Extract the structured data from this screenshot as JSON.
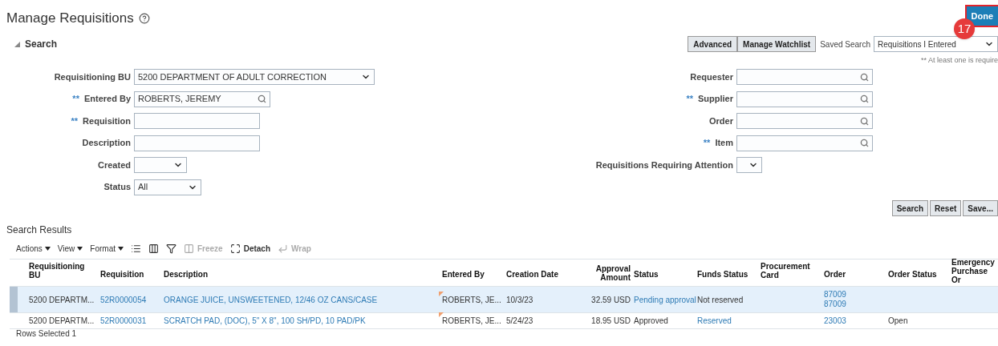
{
  "page": {
    "title": "Manage Requisitions",
    "done_button": "Done",
    "callout": "17"
  },
  "search": {
    "title": "Search",
    "expanded": true,
    "buttons": [
      "Advanced",
      "Manage Watchlist"
    ],
    "saved_search_label": "Saved Search",
    "saved_search_value": "Requisitions I Entered",
    "required_note": "** At least one is require",
    "left_fields": [
      {
        "label": "Requisitioning BU",
        "kind": "select",
        "value": "5200 DEPARTMENT OF ADULT CORRECTION"
      },
      {
        "label": "Entered By",
        "required_mark": "**",
        "kind": "lookup",
        "value": "ROBERTS, JEREMY"
      },
      {
        "label": "Requisition",
        "required_mark": "**",
        "kind": "text"
      },
      {
        "label": "Description",
        "kind": "text"
      },
      {
        "label": "Created",
        "kind": "select"
      },
      {
        "label": "Status",
        "kind": "select",
        "value": "All"
      }
    ],
    "right_fields": [
      {
        "label": "Requester",
        "kind": "lookup"
      },
      {
        "label": "Supplier",
        "required_mark": "**",
        "kind": "lookup"
      },
      {
        "label": "Order",
        "kind": "lookup"
      },
      {
        "label": "Item",
        "required_mark": "**",
        "kind": "lookup"
      },
      {
        "label": "Requisitions Requiring Attention",
        "kind": "select"
      }
    ],
    "actions": [
      "Search",
      "Reset",
      "Save..."
    ]
  },
  "results": {
    "title": "Search Results",
    "toolbar": [
      {
        "kind": "menu",
        "label": "Actions"
      },
      {
        "kind": "menu",
        "label": "View"
      },
      {
        "kind": "menu",
        "label": "Format"
      },
      {
        "kind": "list",
        "disabled": false
      },
      {
        "kind": "columns",
        "disabled": false
      },
      {
        "kind": "filter",
        "disabled": false
      },
      {
        "kind": "freeze",
        "label": "Freeze",
        "disabled": true
      },
      {
        "kind": "detach",
        "label": "Detach",
        "disabled": false
      },
      {
        "kind": "wrap",
        "label": "Wrap",
        "disabled": true
      }
    ],
    "columns": [
      "Requisitioning BU",
      "Requisition",
      "Description",
      "Entered By",
      "Creation Date",
      "Approval Amount",
      "Status",
      "Funds Status",
      "Procurement Card",
      "Order",
      "Order Status",
      "Emergency Purchase Or"
    ],
    "rows": [
      {
        "selected": true,
        "cells": [
          {
            "text": "5200 DEPARTM..."
          },
          {
            "text": "52R0000054",
            "link": true
          },
          {
            "text": "ORANGE JUICE, UNSWEETENED, 12/46 OZ CANS/CASE",
            "link": true
          },
          {
            "text": "ROBERTS, JE...",
            "marker": true
          },
          {
            "text": "10/3/23"
          },
          {
            "text": "32.59 USD"
          },
          {
            "text": "Pending approval",
            "link": true
          },
          {
            "text": "Not reserved"
          },
          {},
          {
            "lines": [
              "87009",
              "87009"
            ],
            "link": true
          },
          {},
          {}
        ]
      },
      {
        "selected": false,
        "cells": [
          {
            "text": "5200 DEPARTM..."
          },
          {
            "text": "52R0000031",
            "link": true
          },
          {
            "text": "SCRATCH PAD, (DOC), 5\" X 8\", 100 SH/PD, 10 PAD/PK",
            "link": true
          },
          {
            "text": "ROBERTS, JE...",
            "marker": true
          },
          {
            "text": "5/24/23"
          },
          {
            "text": "18.95 USD"
          },
          {
            "text": "Approved"
          },
          {
            "text": "Reserved",
            "link": true
          },
          {},
          {
            "lines": [
              "23003"
            ],
            "link": true
          },
          {
            "text": "Open"
          },
          {}
        ]
      }
    ],
    "footer": "Rows Selected 1"
  }
}
